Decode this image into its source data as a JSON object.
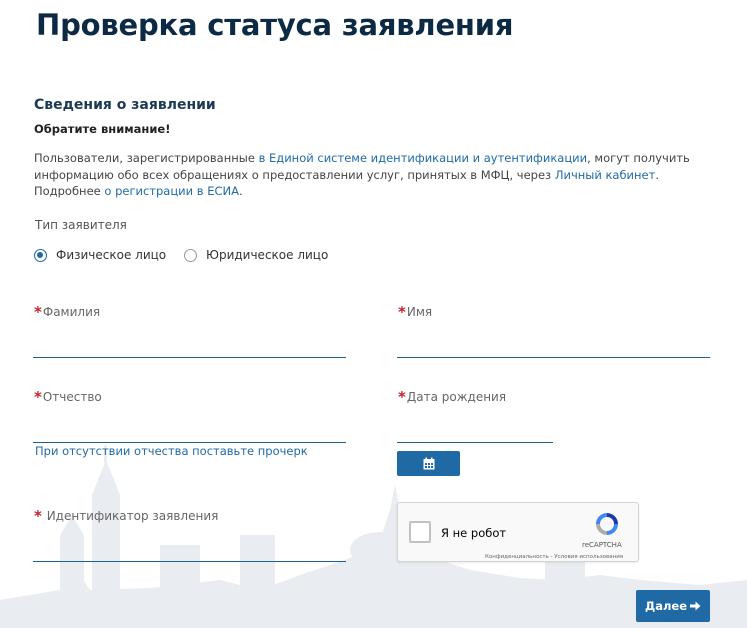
{
  "page": {
    "title": "Проверка статуса заявления"
  },
  "section": {
    "title": "Сведения о заявлении",
    "attention": "Обратите внимание!",
    "notice": {
      "l1_a": "Пользователи, зарегистрированные ",
      "l1_link": "в Единой системе идентификации и аутентификации",
      "l1_b": ", могут получить",
      "l2_a": "информацию обо всех обращениях о предоставлении услуг, принятых в МФЦ, через ",
      "l2_link": "Личный кабинет",
      "l2_b": ".",
      "l3_a": "Подробнее ",
      "l3_link": "о регистрации в ЕСИА",
      "l3_b": "."
    }
  },
  "applicant_type": {
    "label": "Тип заявителя",
    "options": [
      {
        "label": "Физическое лицо",
        "checked": true
      },
      {
        "label": "Юридическое лицо",
        "checked": false
      }
    ]
  },
  "form": {
    "required_mark": "*",
    "last_name": {
      "label": "Фамилия",
      "value": ""
    },
    "first_name": {
      "label": "Имя",
      "value": ""
    },
    "patronymic": {
      "label": "Отчество",
      "value": "",
      "hint": "При отсутствии отчества поставьте прочерк"
    },
    "birth_date": {
      "label": "Дата рождения",
      "value": "",
      "button_icon": "calendar-icon"
    },
    "application_id": {
      "label": "Идентификатор заявления",
      "value": ""
    }
  },
  "captcha": {
    "label": "Я не робот",
    "brand": "reCAPTCHA",
    "legal": "Конфиденциальность - Условия использования",
    "icon": "recaptcha-logo-icon"
  },
  "actions": {
    "next_label": "Далее",
    "next_icon": "arrow-right-icon"
  },
  "colors": {
    "accent": "#1f6aa5",
    "title": "#0d2a45",
    "required": "#c0262d"
  }
}
